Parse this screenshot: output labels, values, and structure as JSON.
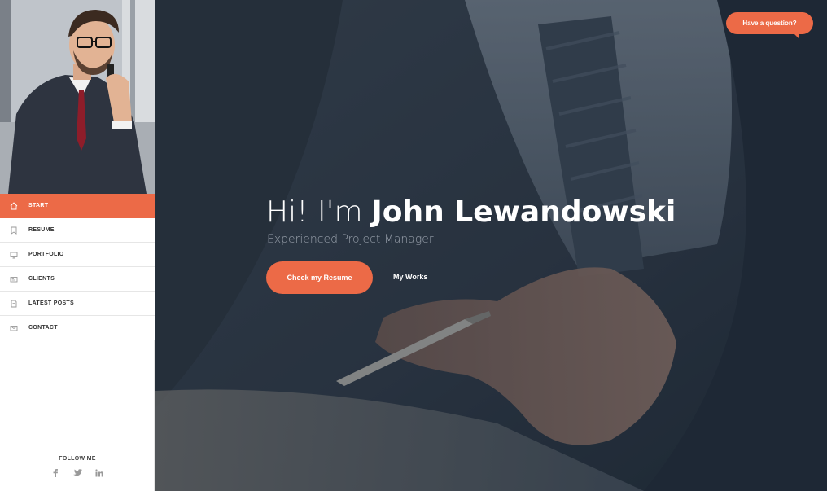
{
  "sidebar": {
    "nav": [
      {
        "label": "START",
        "icon": "home-icon",
        "active": true
      },
      {
        "label": "RESUME",
        "icon": "bookmark-icon",
        "active": false
      },
      {
        "label": "PORTFOLIO",
        "icon": "monitor-icon",
        "active": false
      },
      {
        "label": "CLIENTS",
        "icon": "id-card-icon",
        "active": false
      },
      {
        "label": "LATEST POSTS",
        "icon": "document-icon",
        "active": false
      },
      {
        "label": "CONTACT",
        "icon": "envelope-icon",
        "active": false
      }
    ],
    "follow_label": "FOLLOW ME",
    "social": [
      "facebook-icon",
      "twitter-icon",
      "linkedin-icon"
    ]
  },
  "hero": {
    "greeting": "Hi! I'm",
    "name": "John Lewandowski",
    "subtitle": "Experienced Project Manager",
    "primary_button": "Check my Resume",
    "secondary_link": "My Works"
  },
  "question_bubble": "Have a question?",
  "colors": {
    "accent": "#ec6a47",
    "hero_overlay": "#2f3946"
  }
}
